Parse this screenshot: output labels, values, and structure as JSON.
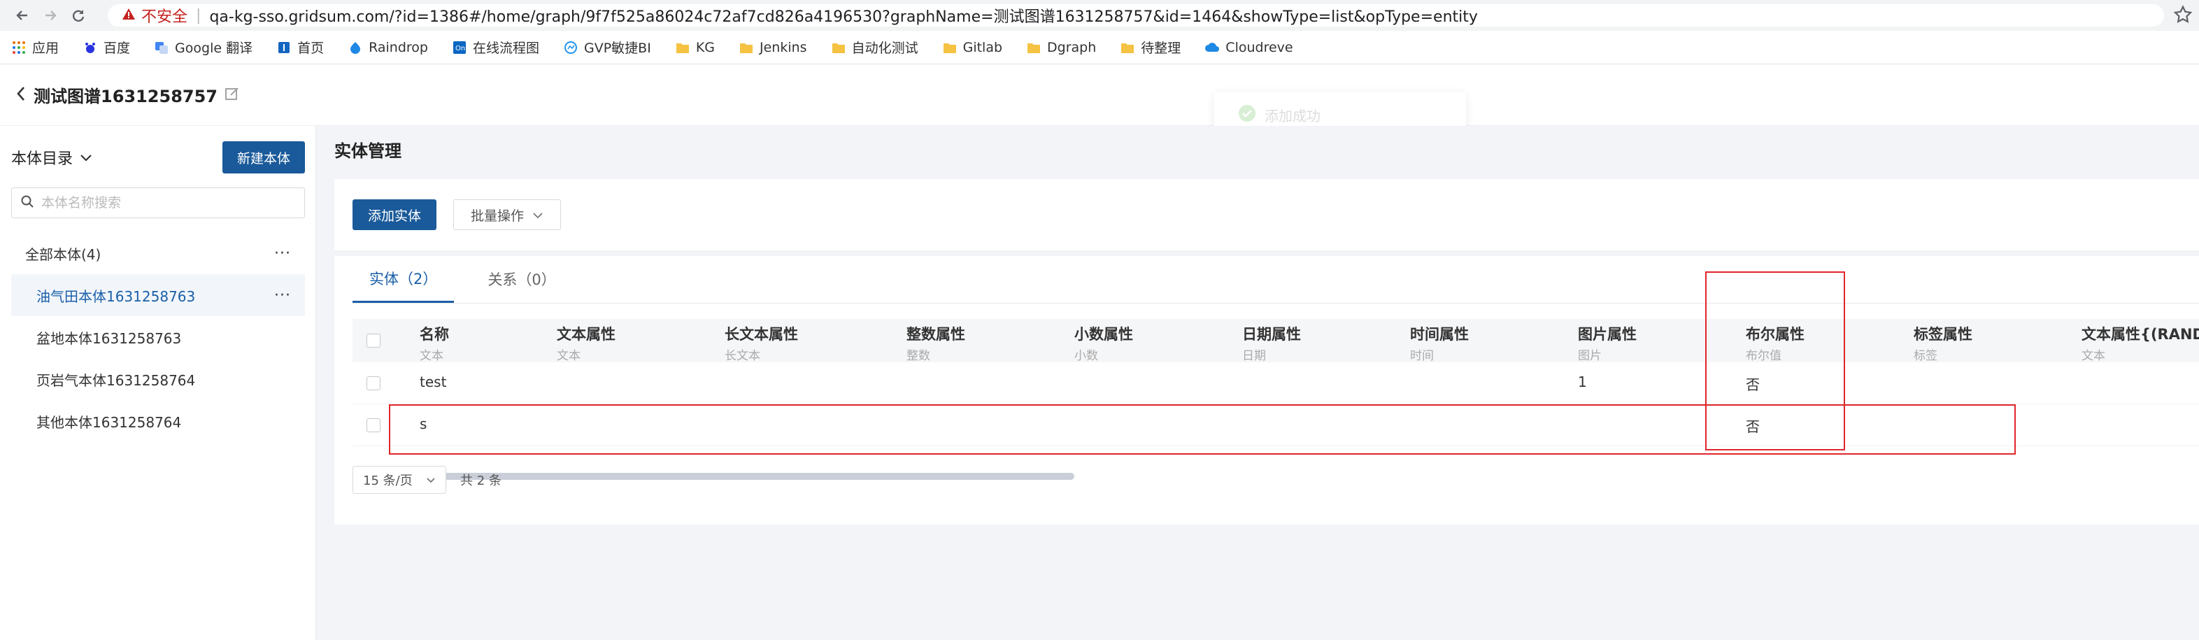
{
  "browser": {
    "insecure_label": "不安全",
    "url": "qa-kg-sso.gridsum.com/?id=1386#/home/graph/9f7f525a86024c72af7cd826a4196530?graphName=测试图谱1631258757&id=1464&showType=list&opType=entity",
    "bookmarks": [
      {
        "label": "应用",
        "icon": "apps-icon"
      },
      {
        "label": "百度",
        "icon": "baidu-icon"
      },
      {
        "label": "Google 翻译",
        "icon": "translate-icon"
      },
      {
        "label": "首页",
        "icon": "home-icon"
      },
      {
        "label": "Raindrop",
        "icon": "raindrop-icon"
      },
      {
        "label": "在线流程图",
        "icon": "flowchart-icon"
      },
      {
        "label": "GVP敏捷BI",
        "icon": "bi-icon"
      },
      {
        "label": "KG",
        "icon": "folder-icon"
      },
      {
        "label": "Jenkins",
        "icon": "folder-icon"
      },
      {
        "label": "自动化测试",
        "icon": "folder-icon"
      },
      {
        "label": "Gitlab",
        "icon": "folder-icon"
      },
      {
        "label": "Dgraph",
        "icon": "folder-icon"
      },
      {
        "label": "待整理",
        "icon": "folder-icon"
      },
      {
        "label": "Cloudreve",
        "icon": "cloud-icon"
      }
    ]
  },
  "header": {
    "title": "测试图谱1631258757",
    "toast": "添加成功"
  },
  "sidebar": {
    "title": "本体目录",
    "new_button": "新建本体",
    "search_placeholder": "本体名称搜索",
    "items": [
      {
        "label": "全部本体(4)",
        "level": 0,
        "menu": true,
        "active": false
      },
      {
        "label": "油气田本体1631258763",
        "level": 1,
        "menu": true,
        "active": true
      },
      {
        "label": "盆地本体1631258763",
        "level": 1,
        "menu": false,
        "active": false
      },
      {
        "label": "页岩气本体1631258764",
        "level": 1,
        "menu": false,
        "active": false
      },
      {
        "label": "其他本体1631258764",
        "level": 1,
        "menu": false,
        "active": false
      }
    ],
    "menu_glyph": "···"
  },
  "main": {
    "page_title": "实体管理",
    "add_entity": "添加实体",
    "batch_ops": "批量操作",
    "tabs": [
      {
        "label": "实体（2）",
        "active": true
      },
      {
        "label": "关系（0）",
        "active": false
      }
    ],
    "columns": [
      {
        "name": "名称",
        "type": "文本"
      },
      {
        "name": "文本属性",
        "type": "文本"
      },
      {
        "name": "长文本属性",
        "type": "长文本"
      },
      {
        "name": "整数属性",
        "type": "整数"
      },
      {
        "name": "小数属性",
        "type": "小数"
      },
      {
        "name": "日期属性",
        "type": "日期"
      },
      {
        "name": "时间属性",
        "type": "时间"
      },
      {
        "name": "图片属性",
        "type": "图片"
      },
      {
        "name": "布尔属性",
        "type": "布尔值"
      },
      {
        "name": "标签属性",
        "type": "标签"
      },
      {
        "name": "文本属性{(RAND",
        "type": "文本"
      }
    ],
    "rows": [
      [
        "test",
        "",
        "",
        "",
        "",
        "",
        "",
        "1",
        "否",
        "",
        ""
      ],
      [
        "s",
        "",
        "",
        "",
        "",
        "",
        "",
        "",
        "否",
        "",
        ""
      ]
    ],
    "page_size": "15 条/页",
    "total": "共 2 条"
  }
}
